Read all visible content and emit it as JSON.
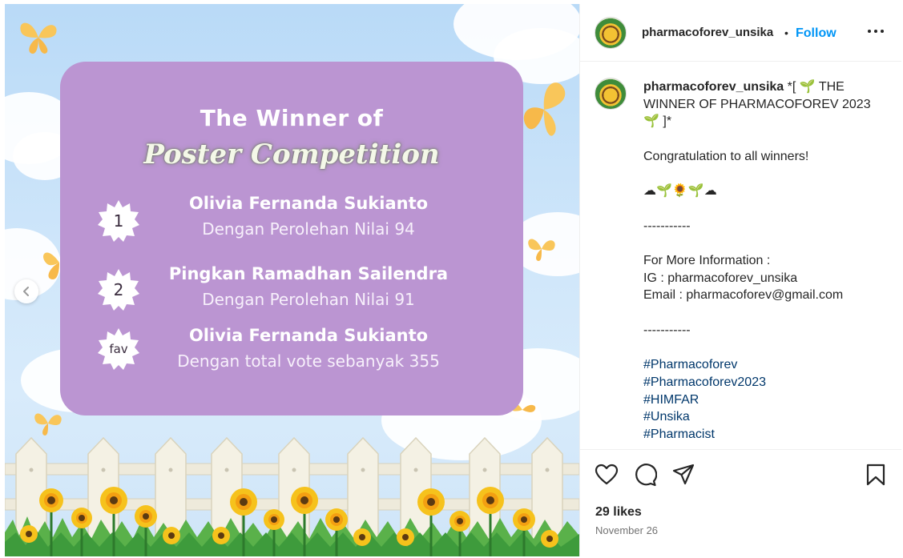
{
  "post_image": {
    "title_line1": "The Winner of",
    "title_line2": "Poster Competition",
    "winners": [
      {
        "badge": "1",
        "name": "Olivia Fernanda Sukianto",
        "detail": "Dengan Perolehan Nilai 94"
      },
      {
        "badge": "2",
        "name": "Pingkan Ramadhan Sailendra",
        "detail": "Dengan Perolehan Nilai 91"
      },
      {
        "badge": "fav",
        "name": "Olivia Fernanda Sukianto",
        "detail": "Dengan total vote sebanyak 355"
      }
    ],
    "prev_icon": "chevron-left-icon",
    "colors": {
      "card": "#bb95d2",
      "sky": "#b9daf7",
      "butterfly": "#f9c65a",
      "flower": "#f6c21c"
    }
  },
  "header": {
    "username": "pharmacoforev_unsika",
    "separator": "•",
    "follow_label": "Follow",
    "more_label": "•••",
    "avatar_text": "2023"
  },
  "caption": {
    "username": "pharmacoforev_unsika",
    "headline": "*[ 🌱 THE WINNER OF PHARMACOFOREV 2023 🌱 ]*",
    "congrats": "Congratulation to all winners!",
    "emoji_line": "☁🌱🌻🌱☁",
    "divider1": "-----------",
    "info_heading": "For More Information :",
    "info_ig": "IG : pharmacoforev_unsika",
    "info_email": "Email : pharmacoforev@gmail.com",
    "divider2": "-----------",
    "hashtags": [
      "#Pharmacoforev",
      "#Pharmacoforev2023",
      "#HIMFAR",
      "#Unsika",
      "#Pharmacist"
    ]
  },
  "actions": {
    "icons": [
      "heart-icon",
      "comment-icon",
      "share-icon",
      "bookmark-icon"
    ],
    "likes": "29 likes",
    "date": "November 26"
  }
}
